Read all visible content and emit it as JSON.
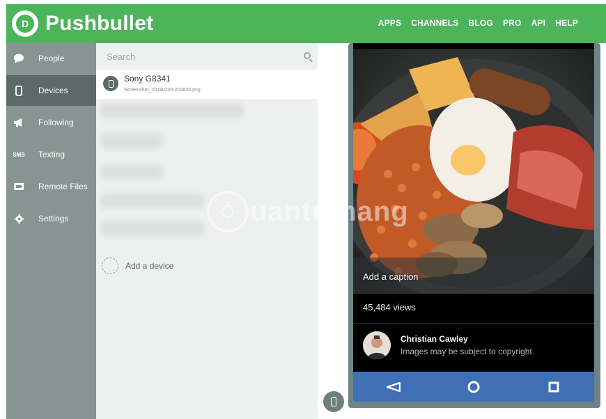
{
  "header": {
    "brand": "Pushbullet",
    "logo_letter": "D",
    "nav": [
      "APPS",
      "CHANNELS",
      "BLOG",
      "PRO",
      "API",
      "HELP"
    ]
  },
  "sidebar": {
    "items": [
      {
        "label": "People",
        "icon": "chat-bubble-icon"
      },
      {
        "label": "Devices",
        "icon": "phone-icon",
        "active": true
      },
      {
        "label": "Following",
        "icon": "megaphone-icon"
      },
      {
        "label": "Texting",
        "icon": "sms-icon",
        "icon_text": "SMS"
      },
      {
        "label": "Remote Files",
        "icon": "folder-icon"
      },
      {
        "label": "Settings",
        "icon": "gear-icon"
      }
    ]
  },
  "devices": {
    "search_placeholder": "Search",
    "selected": {
      "name": "Sony G8341",
      "file": "Screenshot_20190205-204820.png"
    },
    "add_label": "Add a device"
  },
  "phone_screen": {
    "caption": "Add a caption",
    "views": "45,484 views",
    "author_name": "Christian Cawley",
    "author_note": "Images may be subject to copyright."
  },
  "watermark": {
    "text": "uantrimang"
  },
  "colors": {
    "brand_green": "#4cb45a",
    "sidebar": "#869592",
    "sidebar_active": "#5b6967",
    "android_nav": "#3f6fb4"
  }
}
